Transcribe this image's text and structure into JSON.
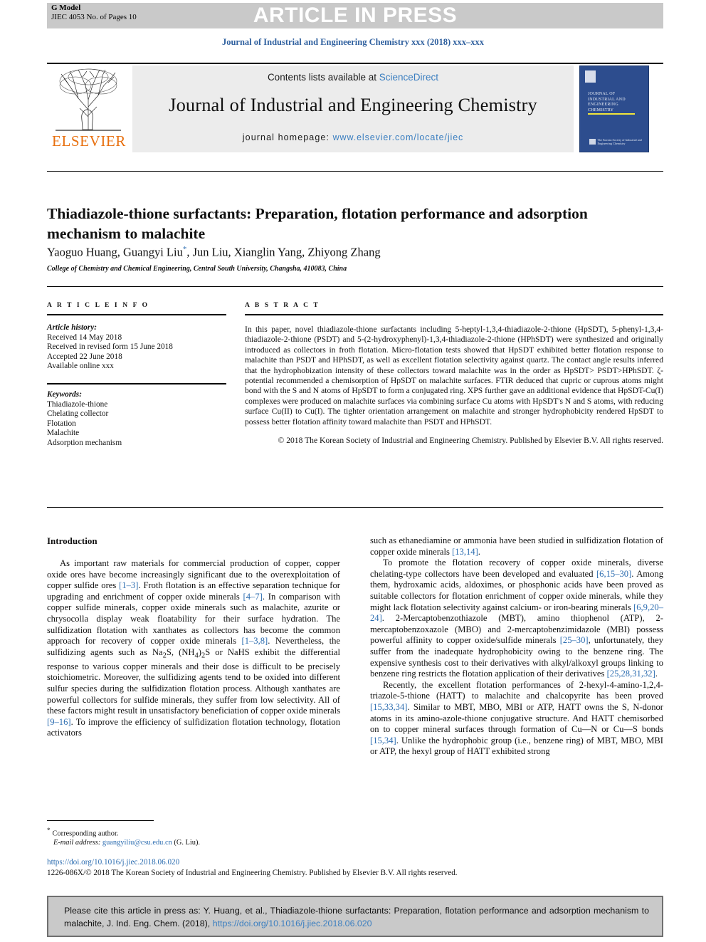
{
  "header": {
    "g_model_label": "G Model",
    "g_model_ref": "JIEC 4053 No. of Pages 10",
    "article_in_press": "ARTICLE IN PRESS",
    "journal_citation": "Journal of Industrial and Engineering Chemistry xxx (2018) xxx–xxx"
  },
  "masthead": {
    "contents_prefix": "Contents lists available at ",
    "sciencedirect": "ScienceDirect",
    "journal_title": "Journal of Industrial and Engineering Chemistry",
    "homepage_label": "journal homepage: ",
    "homepage_url": "www.elsevier.com/locate/jiec",
    "publisher_wordmark": "ELSEVIER",
    "cover_title": "Journal of Industrial and Engineering Chemistry",
    "cover_society": "The Korean Society of Industrial and Engineering Chemistry",
    "accent_blue": "#3a7ec0",
    "elsevier_orange": "#e8700f",
    "cover_navy": "#2d4d8e",
    "cover_rule_yellow": "#f2e63a"
  },
  "article": {
    "title": "Thiadiazole-thione surfactants: Preparation, flotation performance and adsorption mechanism to malachite",
    "authors_part1": "Yaoguo Huang, Guangyi Liu",
    "corresponding_marker": "*",
    "authors_part2": ", Jun Liu, Xianglin Yang, Zhiyong Zhang",
    "affiliation": "College of Chemistry and Chemical Engineering, Central South University, Changsha, 410083, China"
  },
  "info": {
    "kicker": "A R T I C L E   I N F O",
    "history_label": "Article history:",
    "history": [
      "Received 14 May 2018",
      "Received in revised form 15 June 2018",
      "Accepted 22 June 2018",
      "Available online xxx"
    ],
    "keywords_label": "Keywords:",
    "keywords": [
      "Thiadiazole-thione",
      "Chelating collector",
      "Flotation",
      "Malachite",
      "Adsorption mechanism"
    ]
  },
  "abstract": {
    "kicker": "A B S T R A C T",
    "body": "In this paper, novel thiadiazole-thione surfactants including 5-heptyl-1,3,4-thiadiazole-2-thione (HpSDT), 5-phenyl-1,3,4-thiadiazole-2-thione (PSDT) and 5-(2-hydroxyphenyl)-1,3,4-thiadiazole-2-thione (HPhSDT) were synthesized and originally introduced as collectors in froth flotation. Micro-flotation tests showed that HpSDT exhibited better flotation response to malachite than PSDT and HPhSDT, as well as excellent flotation selectivity against quartz. The contact angle results inferred that the hydrophobization intensity of these collectors toward malachite was in the order as HpSDT> PSDT>HPhSDT. ζ-potential recommended a chemisorption of HpSDT on malachite surfaces. FTIR deduced that cupric or cuprous atoms might bond with the S and N atoms of HpSDT to form a conjugated ring. XPS further gave an additional evidence that HpSDT-Cu(I) complexes were produced on malachite surfaces via combining surface Cu atoms with HpSDT's N and S atoms, with reducing surface Cu(II) to Cu(I). The tighter orientation arrangement on malachite and stronger hydrophobicity rendered HpSDT to possess better flotation affinity toward malachite than PSDT and HPhSDT.",
    "copyright": "© 2018 The Korean Society of Industrial and Engineering Chemistry. Published by Elsevier B.V. All rights reserved."
  },
  "introduction": {
    "heading": "Introduction",
    "left": {
      "p1_a": "As important raw materials for commercial production of copper, copper oxide ores have become increasingly significant due to the overexploitation of copper sulfide ores ",
      "p1_ref1": "[1–3]",
      "p1_b": ". Froth flotation is an effective separation technique for upgrading and enrichment of copper oxide minerals ",
      "p1_ref2": "[4–7]",
      "p1_c": ". In comparison with copper sulfide minerals, copper oxide minerals such as malachite, azurite or chrysocolla display weak floatability for their surface hydration. The sulfidization flotation with xanthates as collectors has become the common approach for recovery of copper oxide minerals ",
      "p1_ref3": "[1–3,8]",
      "p1_d": ". Nevertheless, the sulfidizing agents such as Na",
      "p1_sub1": "2",
      "p1_e": "S, (NH",
      "p1_sub2": "4",
      "p1_f": ")",
      "p1_sub3": "2",
      "p1_g": "S or NaHS exhibit the differential response to various copper minerals and their dose is difficult to be precisely stoichiometric. Moreover, the sulfidizing agents tend to be oxided into different sulfur species during the sulfidization flotation process. Although xanthates are powerful collectors for sulfide minerals, they suffer from low selectivity. All of these factors might result in unsatisfactory beneficiation of copper oxide minerals ",
      "p1_ref4": "[9–16]",
      "p1_h": ". To improve the efficiency of sulfidization flotation technology, flotation activators"
    },
    "right": {
      "p0_a": "such as ethanediamine or ammonia have been studied in sulfidization flotation of copper oxide minerals ",
      "p0_ref": "[13,14]",
      "p0_b": ".",
      "p1_a": "To promote the flotation recovery of copper oxide minerals, diverse chelating-type collectors have been developed and evaluated ",
      "p1_ref1": "[6,15–30]",
      "p1_b": ". Among them, hydroxamic acids, aldoximes, or phosphonic acids have been proved as suitable collectors for flotation enrichment of copper oxide minerals, while they might lack flotation selectivity against calcium- or iron-bearing minerals ",
      "p1_ref2": "[6,9,20–24]",
      "p1_c": ". 2-Mercaptobenzothiazole (MBT), amino thiophenol (ATP), 2-mercaptobenzoxazole (MBO) and 2-mercaptobenzimidazole (MBI) possess powerful affinity to copper oxide/sulfide minerals ",
      "p1_ref3": "[25–30]",
      "p1_d": ", unfortunately, they suffer from the inadequate hydrophobicity owing to the benzene ring. The expensive synthesis cost to their derivatives with alkyl/alkoxyl groups linking to benzene ring restricts the flotation application of their derivatives ",
      "p1_ref4": "[25,28,31,32]",
      "p1_e": ".",
      "p2_a": "Recently, the excellent flotation performances of 2-hexyl-4-amino-1,2,4-triazole-5-thione (HATT) to malachite and chalcopyrite has been proved ",
      "p2_ref1": "[15,33,34]",
      "p2_b": ". Similar to MBT, MBO, MBI or ATP, HATT owns the S, N-donor atoms in its amino-azole-thione conjugative structure. And HATT chemisorbed on to copper mineral surfaces through formation of Cu—N or Cu—S bonds ",
      "p2_ref2": "[15,34]",
      "p2_c": ". Unlike the hydrophobic group (i.e., benzene ring) of MBT, MBO, MBI or ATP, the hexyl group of HATT exhibited strong"
    }
  },
  "footer": {
    "corresponding_marker": "*",
    "corresponding_label": "Corresponding author.",
    "email_label": "E-mail address:",
    "email": "guangyiliu@csu.edu.cn",
    "email_suffix": "(G. Liu).",
    "doi": "https://doi.org/10.1016/j.jiec.2018.06.020",
    "issn_line": "1226-086X/© 2018 The Korean Society of Industrial and Engineering Chemistry. Published by Elsevier B.V. All rights reserved."
  },
  "cite_box": {
    "text_a": "Please cite this article in press as: Y. Huang, et al., Thiadiazole-thione surfactants: Preparation, flotation performance and adsorption mechanism to malachite, J. Ind. Eng. Chem. (2018), ",
    "doi": "https://doi.org/10.1016/j.jiec.2018.06.020"
  }
}
